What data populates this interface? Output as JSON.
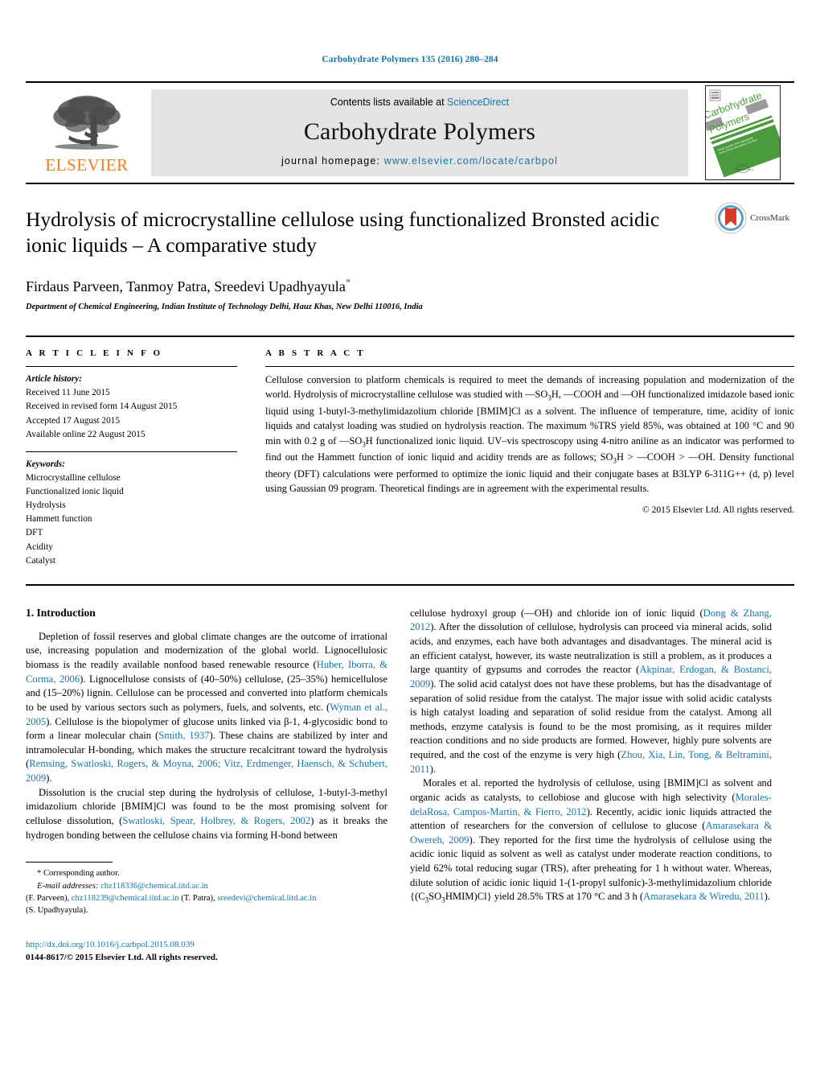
{
  "running_head": "Carbohydrate Polymers 135 (2016) 280–284",
  "masthead": {
    "publisher_name": "ELSEVIER",
    "contents_prefix": "Contents lists available at ",
    "contents_link": "ScienceDirect",
    "journal_name": "Carbohydrate Polymers",
    "homepage_prefix": "journal homepage: ",
    "homepage_url": "www.elsevier.com/locate/carbpol",
    "cover_title_line1": "Carbohydrate",
    "cover_title_line2": "Polymers"
  },
  "article": {
    "title": "Hydrolysis of microcrystalline cellulose using functionalized Bronsted acidic ionic liquids – A comparative study",
    "authors": "Firdaus Parveen, Tanmoy Patra, Sreedevi Upadhyayula",
    "corresponding_marker": "*",
    "affiliation": "Department of Chemical Engineering, Indian Institute of Technology Delhi, Hauz Khas, New Delhi 110016, India",
    "crossmark_label": "CrossMark"
  },
  "info": {
    "section_label": "A R T I C L E    I N F O",
    "history_title": "Article history:",
    "history": [
      "Received 11 June 2015",
      "Received in revised form 14 August 2015",
      "Accepted 17 August 2015",
      "Available online 22 August 2015"
    ],
    "keywords_title": "Keywords:",
    "keywords": [
      "Microcrystalline cellulose",
      "Functionalized ionic liquid",
      "Hydrolysis",
      "Hammett function",
      "DFT",
      "Acidity",
      "Catalyst"
    ]
  },
  "abstract": {
    "section_label": "A B S T R A C T",
    "text": "Cellulose conversion to platform chemicals is required to meet the demands of increasing population and modernization of the world. Hydrolysis of microcrystalline cellulose was studied with —SO3H, —COOH and —OH functionalized imidazole based ionic liquid using 1-butyl-3-methylimidazolium chloride [BMIM]Cl as a solvent. The influence of temperature, time, acidity of ionic liquids and catalyst loading was studied on hydrolysis reaction. The maximum %TRS yield 85%, was obtained at 100 °C and 90 min with 0.2 g of —SO3H functionalized ionic liquid. UV–vis spectroscopy using 4-nitro aniline as an indicator was performed to find out the Hammett function of ionic liquid and acidity trends are as follows; SO3H > —COOH > —OH. Density functional theory (DFT) calculations were performed to optimize the ionic liquid and their conjugate bases at B3LYP 6-311G++ (d, p) level using Gaussian 09 program. Theoretical findings are in agreement with the experimental results.",
    "copyright": "© 2015 Elsevier Ltd. All rights reserved."
  },
  "body": {
    "section_heading": "1.  Introduction",
    "left_paragraphs": [
      "Depletion of fossil reserves and global climate changes are the outcome of irrational use, increasing population and modernization of the global world. Lignocellulosic biomass is the readily available nonfood based renewable resource (Huber, Iborra, & Corma, 2006). Lignocellulose consists of (40–50%) cellulose, (25–35%) hemicellulose and (15–20%) lignin. Cellulose can be processed and converted into platform chemicals to be used by various sectors such as polymers, fuels, and solvents, etc. (Wyman et al., 2005). Cellulose is the biopolymer of glucose units linked via β-1, 4-glycosidic bond to form a linear molecular chain (Smith, 1937). These chains are stabilized by inter and intramolecular H-bonding, which makes the structure recalcitrant toward the hydrolysis (Remsing, Swatloski, Rogers, & Moyna, 2006; Vitz, Erdmenger, Haensch, & Schubert, 2009).",
      "Dissolution is the crucial step during the hydrolysis of cellulose, 1-butyl-3-methyl imidazolium chloride [BMIM]Cl was found to be the most promising solvent for cellulose dissolution, (Swatloski, Spear, Holbrey, & Rogers, 2002) as it breaks the hydrogen bonding between the cellulose chains via forming H-bond between"
    ],
    "right_paragraphs": [
      "cellulose hydroxyl group (—OH) and chloride ion of ionic liquid (Dong & Zhang, 2012). After the dissolution of cellulose, hydrolysis can proceed via mineral acids, solid acids, and enzymes, each have both advantages and disadvantages. The mineral acid is an efficient catalyst, however, its waste neutralization is still a problem, as it produces a large quantity of gypsums and corrodes the reactor (Akpinar, Erdogan, & Bostanci, 2009). The solid acid catalyst does not have these problems, but has the disadvantage of separation of solid residue from the catalyst. The major issue with solid acidic catalysts is high catalyst loading and separation of solid residue from the catalyst. Among all methods, enzyme catalysis is found to be the most promising, as it requires milder reaction conditions and no side products are formed. However, highly pure solvents are required, and the cost of the enzyme is very high (Zhou, Xia, Lin, Tong, & Beltramini, 2011).",
      "Morales et al. reported the hydrolysis of cellulose, using [BMIM]Cl as solvent and organic acids as catalysts, to cellobiose and glucose with high selectivity (Morales-delaRosa, Campos-Martin, & Fierro, 2012). Recently, acidic ionic liquids attracted the attention of researchers for the conversion of cellulose to glucose (Amarasekara & Owereh, 2009). They reported for the first time the hydrolysis of cellulose using the acidic ionic liquid as solvent as well as catalyst under moderate reaction conditions, to yield 62% total reducing sugar (TRS), after preheating for 1 h without water. Whereas, dilute solution of acidic ionic liquid 1-(1-propyl sulfonic)-3-methylimidazolium chloride {(C3SO3HMIM)Cl} yield 28.5% TRS at 170 °C and 3 h (Amarasekara & Wiredu, 2011)."
    ]
  },
  "footnote": {
    "corresponding": "* Corresponding author.",
    "email_label": "E-mail addresses:",
    "email1": "chz118336@chemical.iitd.ac.in",
    "name1": "(F. Parveen),",
    "email2": "chz118239@chemical.iitd.ac.in",
    "name2": "(T. Patra),",
    "email3": "sreedevi@chemical.iitd.ac.in",
    "name3": "(S. Upadhyayula)."
  },
  "doi": {
    "url": "http://dx.doi.org/10.1016/j.carbpol.2015.08.039",
    "issn_line": "0144-8617/© 2015 Elsevier Ltd. All rights reserved."
  },
  "colors": {
    "link": "#1277a8",
    "elsevier_orange": "#ef7d1a",
    "band_gray": "#e4e4e4",
    "cover_green": "#4a9b3c"
  }
}
